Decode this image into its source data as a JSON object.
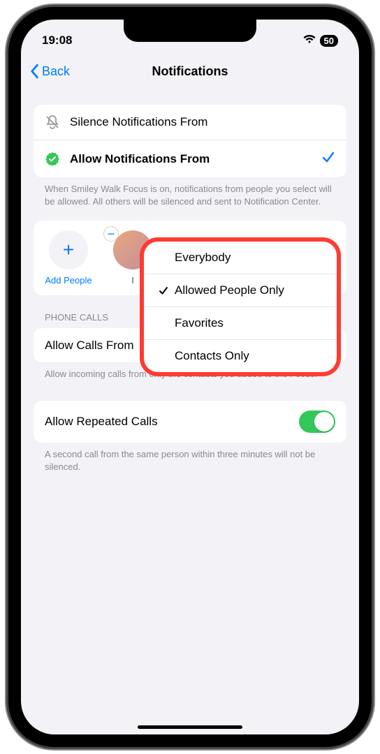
{
  "status": {
    "time": "19:08",
    "battery": "50"
  },
  "nav": {
    "back": "Back",
    "title": "Notifications"
  },
  "modes": {
    "silence": "Silence Notifications From",
    "allow": "Allow Notifications From"
  },
  "modes_footer": "When Smiley Walk Focus is on, notifications from people you select will be allowed. All others will be silenced and sent to Notification Center.",
  "people": {
    "add_label": "Add People",
    "item1_label": "I"
  },
  "popup": {
    "options": [
      {
        "label": "Everybody",
        "checked": false
      },
      {
        "label": "Allowed People Only",
        "checked": true
      },
      {
        "label": "Favorites",
        "checked": false
      },
      {
        "label": "Contacts Only",
        "checked": false
      }
    ]
  },
  "phone_calls": {
    "header": "PHONE CALLS",
    "allow_from_label": "Allow Calls From",
    "allow_from_value": "Allowed People Only",
    "footer": "Allow incoming calls from only the contacts you added to the Focus."
  },
  "repeated": {
    "label": "Allow Repeated Calls",
    "footer": "A second call from the same person within three minutes will not be silenced."
  }
}
